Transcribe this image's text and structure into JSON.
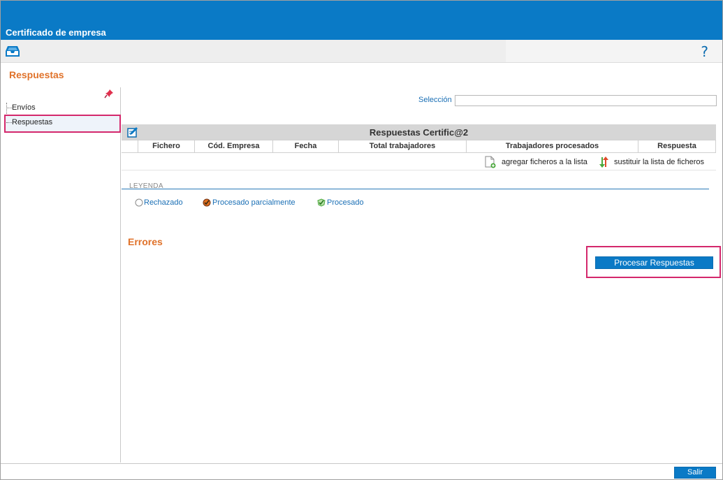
{
  "window": {
    "title": "Certificado de empresa"
  },
  "toolbar": {
    "inbox_icon": "inbox-icon",
    "help_label": "?"
  },
  "page": {
    "section_title": "Respuestas"
  },
  "sidebar": {
    "items": [
      {
        "label": "Envíos"
      },
      {
        "label": "Respuestas",
        "selected": true
      }
    ]
  },
  "selection": {
    "label": "Selección",
    "value": ""
  },
  "grid": {
    "title": "Respuestas Certific@2",
    "columns": [
      "Fichero",
      "Cód. Empresa",
      "Fecha",
      "Total trabajadores",
      "Trabajadores procesados",
      "Respuesta"
    ],
    "actions": {
      "add_label": "agregar ficheros a la lista",
      "replace_label": "sustituir la lista de ficheros"
    }
  },
  "legend": {
    "title": "LEYENDA",
    "items": [
      {
        "label": "Rechazado",
        "icon": "empty-circle-icon"
      },
      {
        "label": "Procesado parcialmente",
        "icon": "partial-icon"
      },
      {
        "label": "Procesado",
        "icon": "check-icon"
      }
    ]
  },
  "errors": {
    "title": "Errores"
  },
  "buttons": {
    "process_label": "Procesar Respuestas",
    "exit_label": "Salir"
  },
  "colors": {
    "accent": "#0a7ac6",
    "section_title": "#e0722a",
    "highlight": "#d4286c"
  }
}
